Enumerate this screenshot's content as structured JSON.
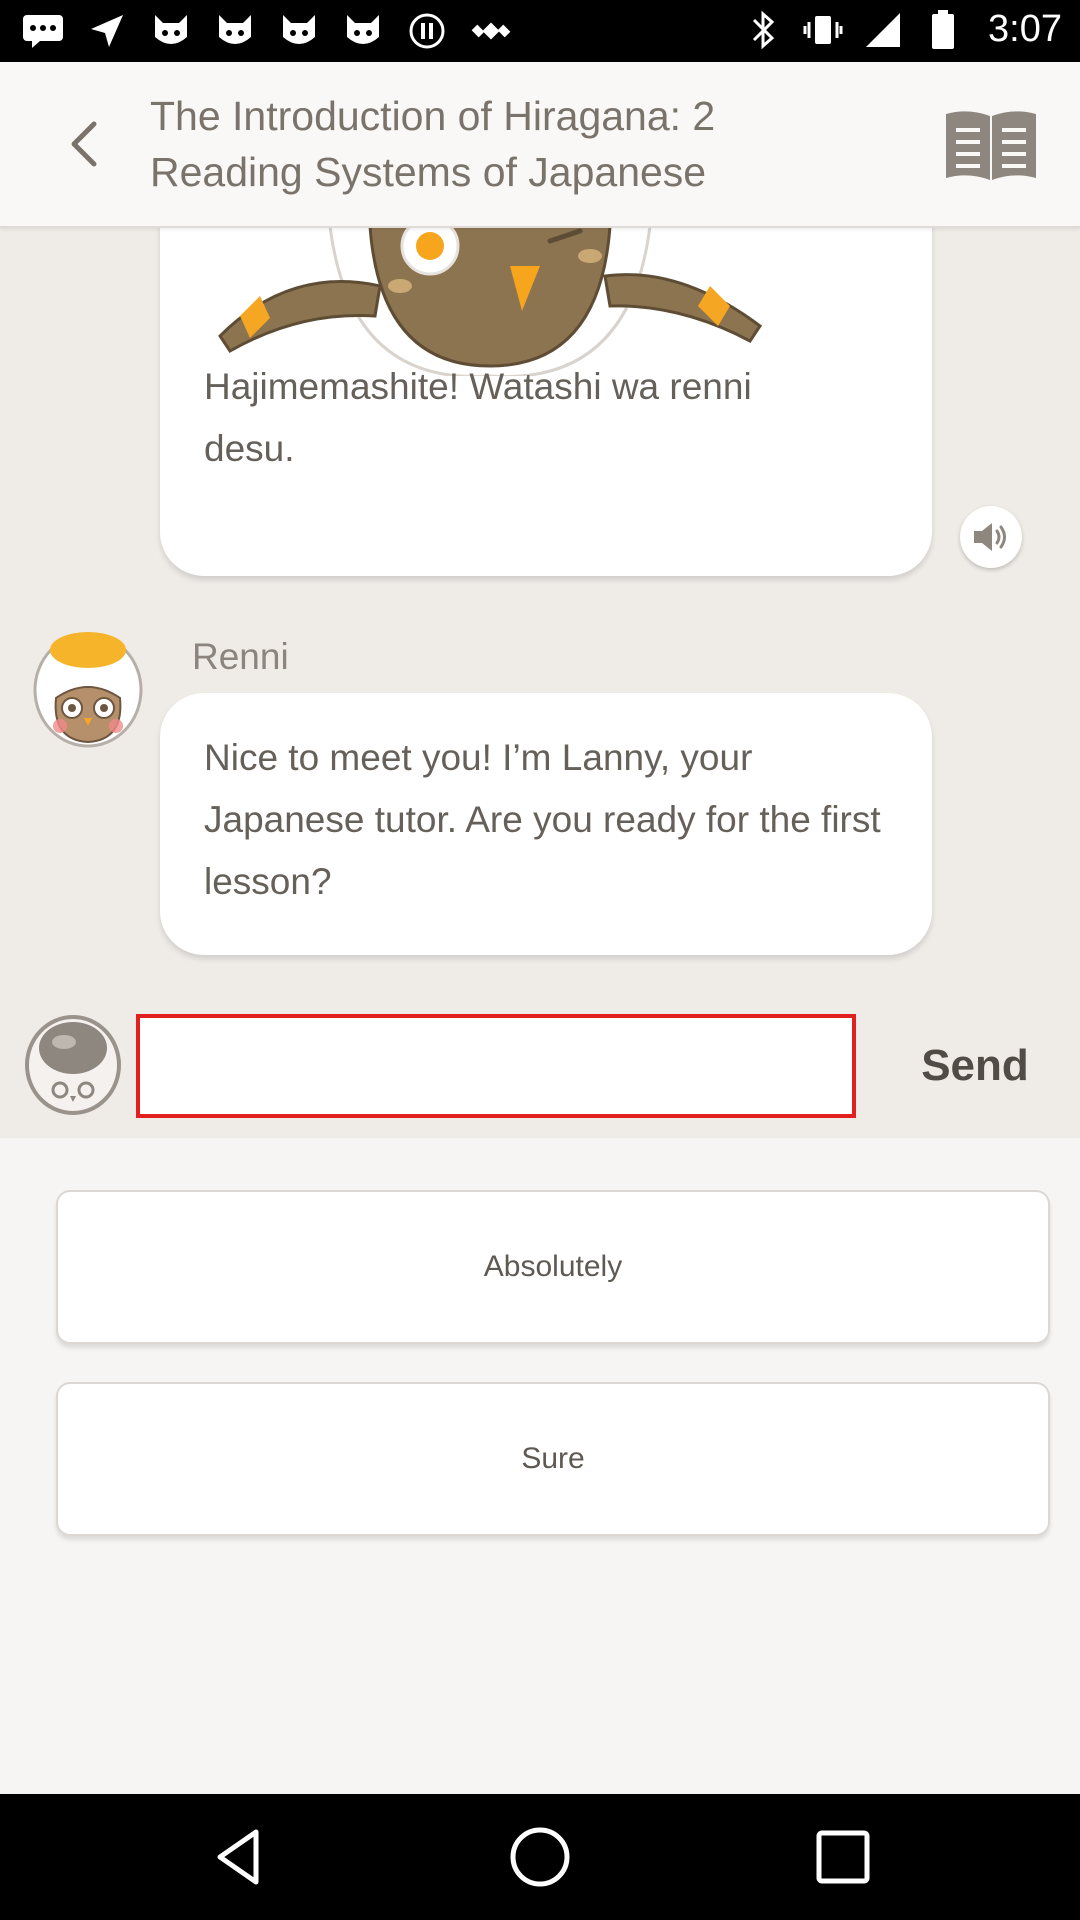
{
  "status_bar": {
    "time": "3:07",
    "left_icons": [
      "messages-icon",
      "navigation-icon",
      "cat-icon",
      "cat-icon",
      "cat-icon",
      "cat-icon",
      "pause-icon",
      "satellite-icon"
    ],
    "right_icons": [
      "bluetooth-icon",
      "vibrate-icon",
      "signal-icon",
      "battery-icon"
    ]
  },
  "header": {
    "title": "The Introduction of Hiragana: 2 Reading Systems of Japanese",
    "back_icon": "chevron-left-icon",
    "book_icon": "book-icon"
  },
  "chat": {
    "messages": [
      {
        "text": "Hajimemashite! Watashi wa renni desu.",
        "has_audio": true
      },
      {
        "sender": "Renni",
        "text": "Nice to meet you! I’m Lanny, your Japanese tutor. Are you ready for the first lesson?"
      }
    ]
  },
  "composer": {
    "input_value": "",
    "send_label": "Send"
  },
  "options": [
    {
      "label": "Absolutely"
    },
    {
      "label": "Sure"
    }
  ],
  "colors": {
    "input_border": "#e1201f",
    "chat_background": "#efebe7",
    "header_background": "#faf8f6",
    "owl_brown": "#8c7451",
    "egg_yolk": "#f6b42b"
  }
}
